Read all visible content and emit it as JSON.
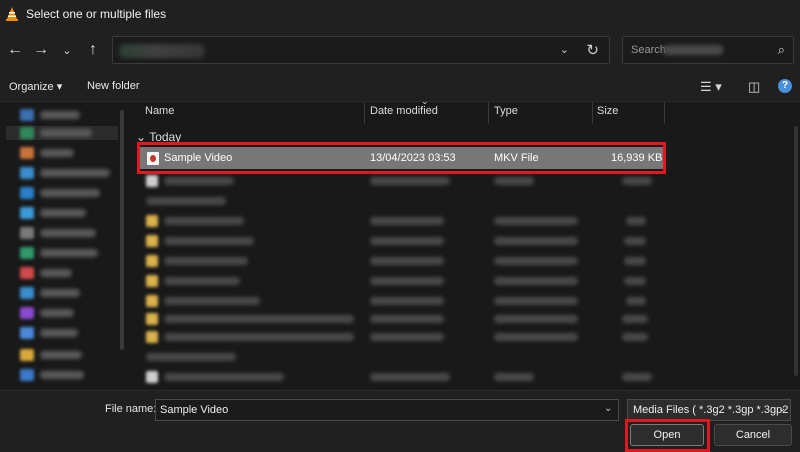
{
  "window": {
    "title": "Select one or multiple files"
  },
  "address_bar": {
    "refresh_icon": "refresh-icon"
  },
  "search": {
    "placeholder": "Search"
  },
  "toolbar": {
    "organize_label": "Organize",
    "new_folder_label": "New folder"
  },
  "columns": {
    "name": "Name",
    "date_modified": "Date modified",
    "type": "Type",
    "size": "Size"
  },
  "groups": {
    "today": "Today"
  },
  "selected_file": {
    "name": "Sample Video",
    "date_modified": "13/04/2023 03:53",
    "type": "MKV File",
    "size": "16,939 KB"
  },
  "file_name_bar": {
    "label": "File name:",
    "value": "Sample Video",
    "filter": "Media Files ( *.3g2 *.3gp *.3gp2"
  },
  "buttons": {
    "open": "Open",
    "cancel": "Cancel"
  },
  "colors": {
    "highlight": "#e2171f",
    "selection": "#777777",
    "background": "#191919"
  }
}
